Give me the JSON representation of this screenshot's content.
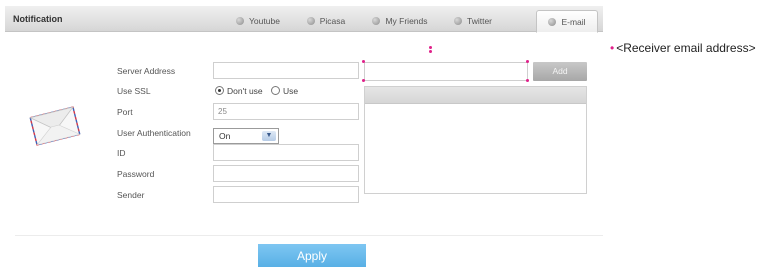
{
  "header": {
    "title": "Notification",
    "tabs": [
      {
        "label": "Youtube",
        "icon": "youtube-icon",
        "active": false
      },
      {
        "label": "Picasa",
        "icon": "picasa-icon",
        "active": false
      },
      {
        "label": "My Friends",
        "icon": "my-friends-icon",
        "active": false
      },
      {
        "label": "Twitter",
        "icon": "twitter-icon",
        "active": false
      },
      {
        "label": "E-mail",
        "icon": "email-icon",
        "active": true
      }
    ]
  },
  "form": {
    "server_address": {
      "label": "Server Address",
      "value": ""
    },
    "use_ssl": {
      "label": "Use SSL",
      "options": [
        "Don't use",
        "Use"
      ],
      "selected": "Don't use"
    },
    "port": {
      "label": "Port",
      "value": "25"
    },
    "user_auth": {
      "label": "User Authentication",
      "value": "On"
    },
    "id": {
      "label": "ID",
      "value": ""
    },
    "password": {
      "label": "Password",
      "value": ""
    },
    "sender": {
      "label": "Sender",
      "value": ""
    }
  },
  "receivers": {
    "input_value": "",
    "add_label": "Add",
    "list_header": "",
    "items": []
  },
  "apply_label": "Apply",
  "annotation": {
    "bullet": "•",
    "text": "<Receiver email address>"
  },
  "colors": {
    "accent": "#5fb4e8",
    "highlight": "#e0218a",
    "header_bg": "#dcdcdc"
  }
}
